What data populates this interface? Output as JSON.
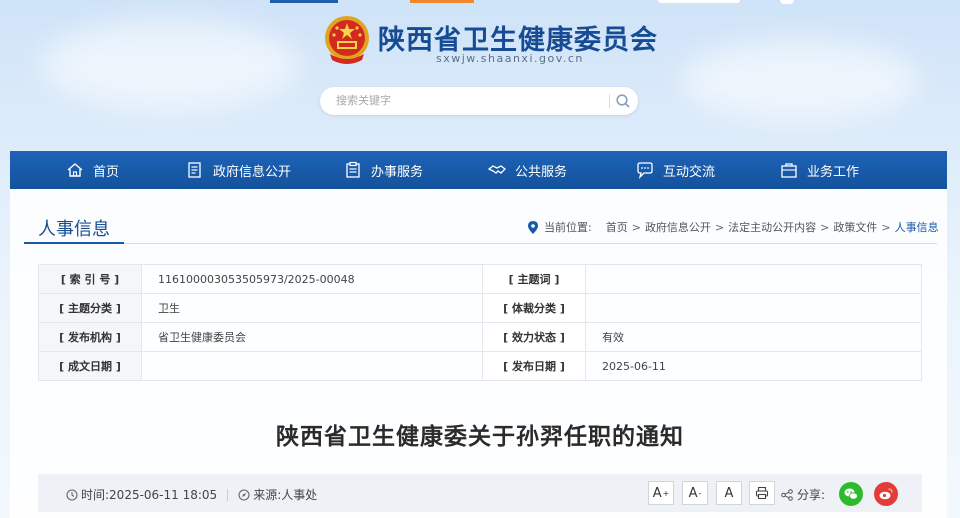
{
  "header": {
    "site_name": "陕西省卫生健康委员会",
    "domain": "sxwjw.shaanxi.gov.cn",
    "search_placeholder": "搜索关键字"
  },
  "nav": {
    "items": [
      {
        "label": "首页",
        "icon": "home-icon"
      },
      {
        "label": "政府信息公开",
        "icon": "document-icon"
      },
      {
        "label": "办事服务",
        "icon": "clipboard-icon"
      },
      {
        "label": "公共服务",
        "icon": "handshake-icon"
      },
      {
        "label": "互动交流",
        "icon": "chat-icon"
      },
      {
        "label": "业务工作",
        "icon": "briefcase-icon"
      }
    ]
  },
  "section": {
    "title": "人事信息",
    "breadcrumb_label": "当前位置:",
    "breadcrumb": [
      "首页",
      "政府信息公开",
      "法定主动公开内容",
      "政策文件",
      "人事信息"
    ]
  },
  "meta": {
    "rows": [
      {
        "k1": "[ 索 引 号 ]",
        "v1": "116100003053505973/2025-00048",
        "k2": "[ 主题词 ]",
        "v2": ""
      },
      {
        "k1": "[ 主题分类 ]",
        "v1": "卫生",
        "k2": "[ 体裁分类 ]",
        "v2": ""
      },
      {
        "k1": "[ 发布机构 ]",
        "v1": "省卫生健康委员会",
        "k2": "[ 效力状态 ]",
        "v2": "有效"
      },
      {
        "k1": "[ 成文日期 ]",
        "v1": "",
        "k2": "[ 发布日期 ]",
        "v2": "2025-06-11"
      }
    ]
  },
  "article": {
    "title": "陕西省卫生健康委关于孙羿任职的通知",
    "time_label": "时间:",
    "time": "2025-06-11 18:05",
    "source_label": "来源:",
    "source": "人事处",
    "font_buttons": [
      "A",
      "A",
      "A"
    ],
    "share_label": "分享:"
  },
  "colors": {
    "nav_bg": "#1d63b8",
    "title_blue": "#174c95",
    "wechat_green": "#2dbb2e",
    "weibo_red": "#e33b3b"
  }
}
